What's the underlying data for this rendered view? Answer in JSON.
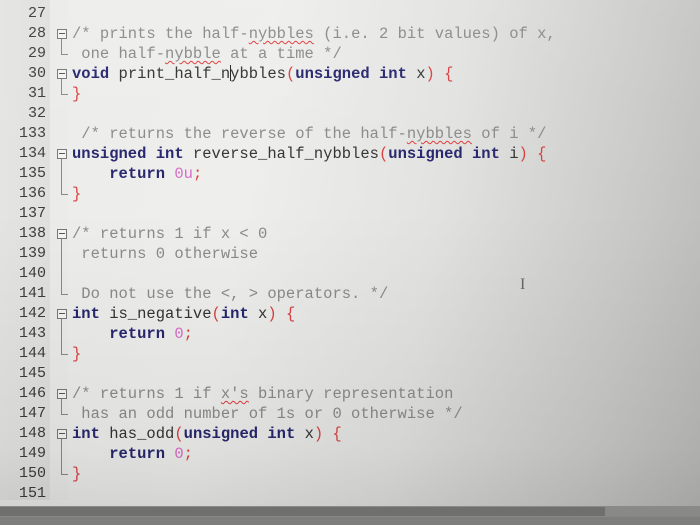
{
  "editor": {
    "language": "C",
    "colors": {
      "comment": "#8a8a8a",
      "keyword": "#26266e",
      "identifier": "#333333",
      "operator": "#d84040",
      "number": "#d86bc9",
      "spellcheck_underline": "#e03a3a"
    },
    "lines": [
      {
        "n": "27",
        "tokens": []
      },
      {
        "n": "28",
        "fold": "start",
        "tokens": [
          {
            "t": "cm",
            "v": "/* prints the half-"
          },
          {
            "t": "cm squig",
            "v": "nybbles"
          },
          {
            "t": "cm",
            "v": " (i.e. 2 bit values) of x,"
          }
        ]
      },
      {
        "n": "29",
        "fold": "end",
        "tokens": [
          {
            "t": "cm",
            "v": " one half-"
          },
          {
            "t": "cm squig",
            "v": "nybble"
          },
          {
            "t": "cm",
            "v": " at a time */"
          }
        ]
      },
      {
        "n": "30",
        "fold": "start",
        "tokens": [
          {
            "t": "kw",
            "v": "void"
          },
          {
            "t": "id",
            "v": " print_half_n"
          },
          {
            "t": "caret",
            "v": ""
          },
          {
            "t": "id",
            "v": "ybbles"
          },
          {
            "t": "op",
            "v": "("
          },
          {
            "t": "kw",
            "v": "unsigned int"
          },
          {
            "t": "id",
            "v": " x"
          },
          {
            "t": "op",
            "v": ") {"
          }
        ]
      },
      {
        "n": "31",
        "fold": "end",
        "tokens": [
          {
            "t": "op",
            "v": "}"
          }
        ]
      },
      {
        "n": "32",
        "tokens": []
      },
      {
        "n": "133",
        "tokens": [
          {
            "t": "cm",
            "v": " /* returns the reverse of the half-"
          },
          {
            "t": "cm squig",
            "v": "nybbles"
          },
          {
            "t": "cm",
            "v": " of i */"
          }
        ]
      },
      {
        "n": "134",
        "fold": "start",
        "tokens": [
          {
            "t": "kw",
            "v": "unsigned int"
          },
          {
            "t": "id",
            "v": " reverse_half_nybbles"
          },
          {
            "t": "op",
            "v": "("
          },
          {
            "t": "kw",
            "v": "unsigned int"
          },
          {
            "t": "id",
            "v": " i"
          },
          {
            "t": "op",
            "v": ") {"
          }
        ]
      },
      {
        "n": "135",
        "fold": "mid",
        "tokens": [
          {
            "t": "id",
            "v": "    "
          },
          {
            "t": "kw",
            "v": "return"
          },
          {
            "t": "id",
            "v": " "
          },
          {
            "t": "num",
            "v": "0u"
          },
          {
            "t": "op",
            "v": ";"
          }
        ]
      },
      {
        "n": "136",
        "fold": "end",
        "tokens": [
          {
            "t": "op",
            "v": "}"
          }
        ]
      },
      {
        "n": "137",
        "tokens": []
      },
      {
        "n": "138",
        "fold": "start",
        "tokens": [
          {
            "t": "cm",
            "v": "/* returns 1 if x < 0"
          }
        ]
      },
      {
        "n": "139",
        "fold": "mid",
        "tokens": [
          {
            "t": "cm",
            "v": " returns 0 otherwise"
          }
        ]
      },
      {
        "n": "140",
        "fold": "mid",
        "tokens": []
      },
      {
        "n": "141",
        "fold": "end",
        "tokens": [
          {
            "t": "cm",
            "v": " Do not use the <, > operators. */"
          }
        ]
      },
      {
        "n": "142",
        "fold": "start",
        "tokens": [
          {
            "t": "kw",
            "v": "int"
          },
          {
            "t": "id",
            "v": " is_negative"
          },
          {
            "t": "op",
            "v": "("
          },
          {
            "t": "kw",
            "v": "int"
          },
          {
            "t": "id",
            "v": " x"
          },
          {
            "t": "op",
            "v": ") {"
          }
        ]
      },
      {
        "n": "143",
        "fold": "mid",
        "tokens": [
          {
            "t": "id",
            "v": "    "
          },
          {
            "t": "kw",
            "v": "return"
          },
          {
            "t": "id",
            "v": " "
          },
          {
            "t": "num",
            "v": "0"
          },
          {
            "t": "op",
            "v": ";"
          }
        ]
      },
      {
        "n": "144",
        "fold": "end",
        "tokens": [
          {
            "t": "op",
            "v": "}"
          }
        ]
      },
      {
        "n": "145",
        "tokens": []
      },
      {
        "n": "146",
        "fold": "start",
        "tokens": [
          {
            "t": "cm",
            "v": "/* returns 1 if "
          },
          {
            "t": "cm squig",
            "v": "x's"
          },
          {
            "t": "cm",
            "v": " binary representation"
          }
        ]
      },
      {
        "n": "147",
        "fold": "end",
        "tokens": [
          {
            "t": "cm",
            "v": " has an odd number of 1s or 0 otherwise */"
          }
        ]
      },
      {
        "n": "148",
        "fold": "start",
        "tokens": [
          {
            "t": "kw",
            "v": "int"
          },
          {
            "t": "id",
            "v": " has_odd"
          },
          {
            "t": "op",
            "v": "("
          },
          {
            "t": "kw",
            "v": "unsigned int"
          },
          {
            "t": "id",
            "v": " x"
          },
          {
            "t": "op",
            "v": ") {"
          }
        ]
      },
      {
        "n": "149",
        "fold": "mid",
        "tokens": [
          {
            "t": "id",
            "v": "    "
          },
          {
            "t": "kw",
            "v": "return"
          },
          {
            "t": "id",
            "v": " "
          },
          {
            "t": "num",
            "v": "0"
          },
          {
            "t": "op",
            "v": ";"
          }
        ]
      },
      {
        "n": "150",
        "fold": "end",
        "tokens": [
          {
            "t": "op",
            "v": "}"
          }
        ]
      },
      {
        "n": "151",
        "tokens": []
      }
    ]
  },
  "mouse_cursor": {
    "icon": "i-beam-cursor-icon",
    "glyph": "I"
  }
}
